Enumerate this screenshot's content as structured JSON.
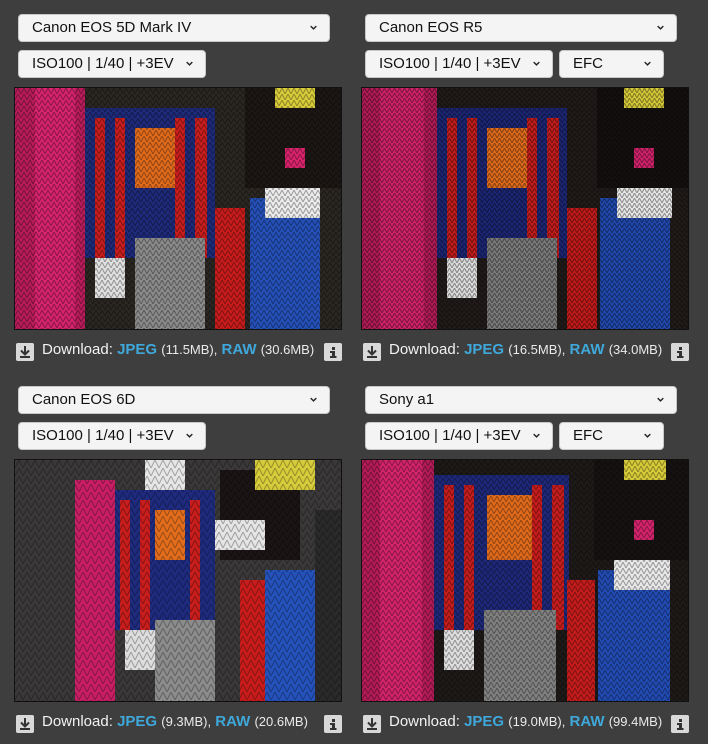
{
  "panels": [
    {
      "camera": "Canon EOS 5D Mark IV",
      "settings": "ISO100 | 1/40 | +3EV",
      "mode": null,
      "download_label": "Download:",
      "jpeg_label": "JPEG",
      "jpeg_size": "(11.5MB),",
      "raw_label": "RAW",
      "raw_size": "(30.6MB)"
    },
    {
      "camera": "Canon EOS R5",
      "settings": "ISO100 | 1/40 | +3EV",
      "mode": "EFC",
      "download_label": "Download:",
      "jpeg_label": "JPEG",
      "jpeg_size": "(16.5MB),",
      "raw_label": "RAW",
      "raw_size": "(34.0MB)"
    },
    {
      "camera": "Canon EOS 6D",
      "settings": "ISO100 | 1/40 | +3EV",
      "mode": null,
      "download_label": "Download:",
      "jpeg_label": "JPEG",
      "jpeg_size": "(9.3MB),",
      "raw_label": "RAW",
      "raw_size": "(20.6MB)"
    },
    {
      "camera": "Sony a1",
      "settings": "ISO100 | 1/40 | +3EV",
      "mode": "EFC",
      "download_label": "Download:",
      "jpeg_label": "JPEG",
      "jpeg_size": "(19.0MB),",
      "raw_label": "RAW",
      "raw_size": "(99.4MB)"
    }
  ],
  "icons": {
    "dropdown": "chevron-down-icon",
    "download": "download-icon",
    "info": "info-icon"
  },
  "colors": {
    "background": "#3e3e3e",
    "link": "#3fa8db",
    "select_bg": "#f4f4f4"
  }
}
